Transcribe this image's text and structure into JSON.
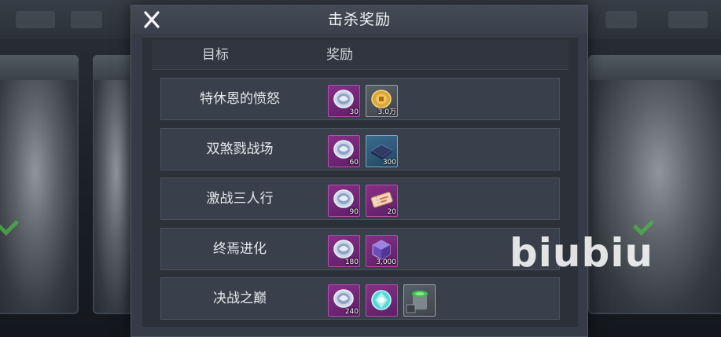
{
  "dialog": {
    "title": "击杀奖励",
    "close_label": "X"
  },
  "columns": {
    "target": "目标",
    "reward": "奖励"
  },
  "rows": [
    {
      "name": "特休恩的愤怒",
      "rewards": [
        {
          "icon": "silver-coin-icon",
          "rarity": "purple",
          "qty": "30"
        },
        {
          "icon": "gold-coin-icon",
          "rarity": "grey",
          "qty": "3.0万"
        }
      ]
    },
    {
      "name": "双煞戮战场",
      "rewards": [
        {
          "icon": "silver-coin-icon",
          "rarity": "purple",
          "qty": "60"
        },
        {
          "icon": "blueprint-crate-icon",
          "rarity": "blue",
          "qty": "300"
        }
      ]
    },
    {
      "name": "激战三人行",
      "rewards": [
        {
          "icon": "silver-coin-icon",
          "rarity": "purple",
          "qty": "90"
        },
        {
          "icon": "ticket-icon",
          "rarity": "purple",
          "qty": "20"
        }
      ]
    },
    {
      "name": "终焉进化",
      "rewards": [
        {
          "icon": "silver-coin-icon",
          "rarity": "purple",
          "qty": "180"
        },
        {
          "icon": "crystal-cube-icon",
          "rarity": "purple",
          "qty": "3,000"
        }
      ]
    },
    {
      "name": "决战之巅",
      "rewards": [
        {
          "icon": "silver-coin-icon",
          "rarity": "purple",
          "qty": "240"
        },
        {
          "icon": "gem-orb-icon",
          "rarity": "purple",
          "qty": ""
        },
        {
          "icon": "green-canister-icon",
          "rarity": "grey",
          "qty": ""
        }
      ]
    }
  ],
  "watermark": "biubiu",
  "colors": {
    "panel": "#363c47",
    "row": "#3a404b",
    "rarity_purple": "#7a2b7a",
    "rarity_blue": "#2f5a78",
    "rarity_grey": "#4e545c",
    "check_green": "#49b24a"
  }
}
